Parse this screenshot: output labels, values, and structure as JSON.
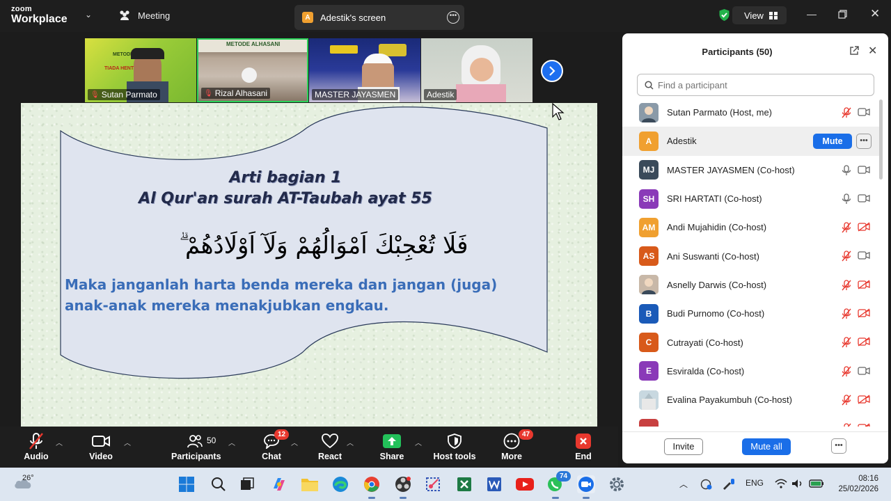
{
  "app": {
    "brand_top": "zoom",
    "brand_bottom": "Workplace",
    "meeting_tab": "Meeting"
  },
  "screen_tab": {
    "badge": "A",
    "title": "Adestik's screen"
  },
  "view_button": "View",
  "video_tiles": [
    {
      "name": "Sutan Parmato",
      "muted": true,
      "banner": "METODE AL HASANI",
      "banner2": "TIADA HENTI MENGAJI"
    },
    {
      "name": "Rizal Alhasani",
      "muted": true,
      "banner": "METODE ALHASANI"
    },
    {
      "name": "MASTER JAYASMEN",
      "muted": false
    },
    {
      "name": "Adestik",
      "muted": false
    }
  ],
  "slide": {
    "title_line1": "Arti  bagian 1",
    "title_line2": "Al Qur'an surah AT-Taubah ayat  55",
    "arabic": "فَلَا تُعْجِبْكَ اَمْوَالُهُمْ وَلَآ اَوْلَادُهُمْ ۗ",
    "translation": "Maka janganlah harta benda mereka dan jangan (juga) anak-anak mereka menakjubkan    engkau."
  },
  "toolbar": {
    "audio": "Audio",
    "video": "Video",
    "participants": "Participants",
    "participants_count": "50",
    "chat": "Chat",
    "chat_badge": "12",
    "react": "React",
    "share": "Share",
    "host_tools": "Host tools",
    "more": "More",
    "more_badge": "47",
    "end": "End"
  },
  "panel": {
    "title": "Participants (50)",
    "search_placeholder": "Find a participant",
    "mute_label": "Mute",
    "invite": "Invite",
    "mute_all": "Mute all",
    "participants": [
      {
        "name": "Sutan Parmato (Host, me)",
        "initials": "",
        "color": "#8a9aa8",
        "mic": "off",
        "cam": "on"
      },
      {
        "name": "Adestik",
        "initials": "A",
        "color": "#f0a030",
        "mic": "hover",
        "cam": "hover"
      },
      {
        "name": "MASTER JAYASMEN (Co-host)",
        "initials": "MJ",
        "color": "#3a4a5a",
        "mic": "on",
        "cam": "on"
      },
      {
        "name": "SRI HARTATI (Co-host)",
        "initials": "SH",
        "color": "#8a3ab8",
        "mic": "on",
        "cam": "on"
      },
      {
        "name": "Andi Mujahidin (Co-host)",
        "initials": "AM",
        "color": "#f0a030",
        "mic": "off",
        "cam": "off"
      },
      {
        "name": "Ani Suswanti (Co-host)",
        "initials": "AS",
        "color": "#d85a1a",
        "mic": "off",
        "cam": "on"
      },
      {
        "name": "Asnelly Darwis (Co-host)",
        "initials": "",
        "color": "#c8b8a8",
        "mic": "off",
        "cam": "off"
      },
      {
        "name": "Budi Purnomo (Co-host)",
        "initials": "B",
        "color": "#1a5ab8",
        "mic": "off",
        "cam": "off"
      },
      {
        "name": "Cutrayati (Co-host)",
        "initials": "C",
        "color": "#d85a1a",
        "mic": "off",
        "cam": "off"
      },
      {
        "name": "Esviralda (Co-host)",
        "initials": "E",
        "color": "#8a3ab8",
        "mic": "off",
        "cam": "on"
      },
      {
        "name": "Evalina Payakumbuh (Co-host)",
        "initials": "",
        "color": "#9ab0b8",
        "mic": "off",
        "cam": "off"
      },
      {
        "name": "",
        "initials": "",
        "color": "#c84040",
        "mic": "off",
        "cam": "off"
      }
    ]
  },
  "taskbar": {
    "temperature": "26°",
    "whatsapp_badge": "74",
    "language": "ENG",
    "time": "08:16",
    "date": "25/02/2026"
  }
}
